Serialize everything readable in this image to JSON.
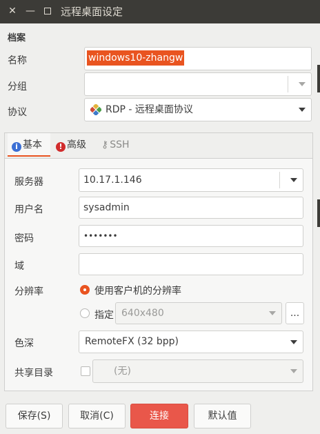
{
  "window": {
    "title": "远程桌面设定",
    "close_glyph": "✕",
    "min_glyph": "—"
  },
  "profile": {
    "section_title": "档案",
    "name_label": "名称",
    "name_value": "windows10-zhangw",
    "group_label": "分组",
    "group_value": "",
    "protocol_label": "协议",
    "protocol_value": "RDP - 远程桌面协议",
    "protocol_icon": "rdp-diamond-icon"
  },
  "tabs": [
    {
      "label": "基本",
      "icon": "info-icon",
      "icon_glyph": "i",
      "icon_color": "#3b6fd4",
      "active": true
    },
    {
      "label": "高级",
      "icon": "warning-icon",
      "icon_glyph": "!",
      "icon_color": "#d12c2c",
      "active": false
    },
    {
      "label": "SSH",
      "icon": "key-icon",
      "icon_glyph": "⚷",
      "active": false
    }
  ],
  "basic": {
    "server_label": "服务器",
    "server_value": "10.17.1.146",
    "user_label": "用户名",
    "user_value": "sysadmin",
    "password_label": "密码",
    "password_value": "•••••••",
    "domain_label": "域",
    "domain_value": "",
    "resolution_label": "分辨率",
    "res_option_client": "使用客户机的分辨率",
    "res_option_custom": "指定",
    "res_custom_value": "640x480",
    "res_more_label": "...",
    "color_label": "色深",
    "color_value": "RemoteFX (32 bpp)",
    "share_label": "共享目录",
    "share_value": "(无)"
  },
  "buttons": {
    "save": "保存(S)",
    "cancel": "取消(C)",
    "connect": "连接",
    "default": "默认值"
  },
  "colors": {
    "accent": "#e95420",
    "connect": "#e9574a",
    "titlebar": "#3c3b37"
  }
}
